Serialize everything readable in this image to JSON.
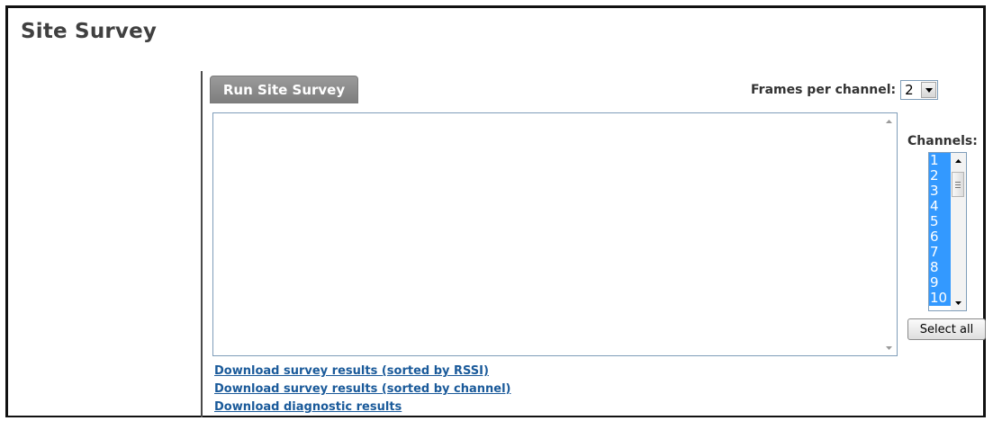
{
  "page": {
    "title": "Site Survey"
  },
  "toolbar": {
    "run_label": "Run Site Survey",
    "frames_label": "Frames per channel:",
    "frames_value": "2"
  },
  "results": {
    "text": ""
  },
  "channels": {
    "label": "Channels:",
    "items": [
      "1",
      "2",
      "3",
      "4",
      "5",
      "6",
      "7",
      "8",
      "9",
      "10"
    ],
    "selected_all": true,
    "select_all_label": "Select all"
  },
  "links": [
    "Download survey results (sorted by RSSI)",
    "Download survey results (sorted by channel)",
    "Download diagnostic results"
  ],
  "colors": {
    "selection": "#3399ff",
    "link": "#1a5a9a",
    "button_gray": "#8a8a8a"
  }
}
